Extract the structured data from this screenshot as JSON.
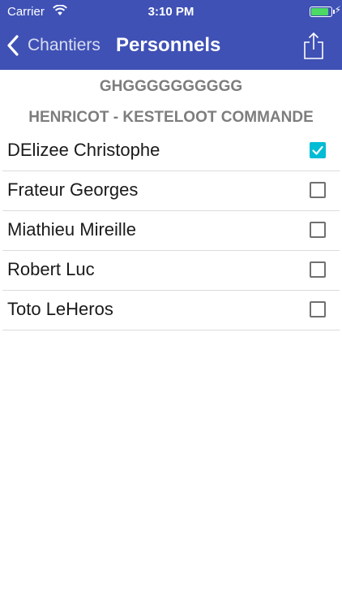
{
  "status_bar": {
    "carrier": "Carrier",
    "time": "3:10 PM",
    "battery_level": 0.9,
    "battery_color": "#4cd964"
  },
  "nav": {
    "back_label": "Chantiers",
    "title": "Personnels",
    "share_icon": "share-icon",
    "background": "#3f51b5"
  },
  "subtitles": {
    "line1": "GHGGGGGGGGGG",
    "line2": "HENRICOT - KESTELOOT COMMANDE"
  },
  "personnel": [
    {
      "name": "DElizee Christophe",
      "checked": true
    },
    {
      "name": "Frateur Georges",
      "checked": false
    },
    {
      "name": "Miathieu Mireille",
      "checked": false
    },
    {
      "name": "Robert Luc",
      "checked": false
    },
    {
      "name": "Toto LeHeros",
      "checked": false
    }
  ],
  "colors": {
    "checkbox_checked": "#00bcd4",
    "subtitle_text": "#7d7d7d"
  }
}
